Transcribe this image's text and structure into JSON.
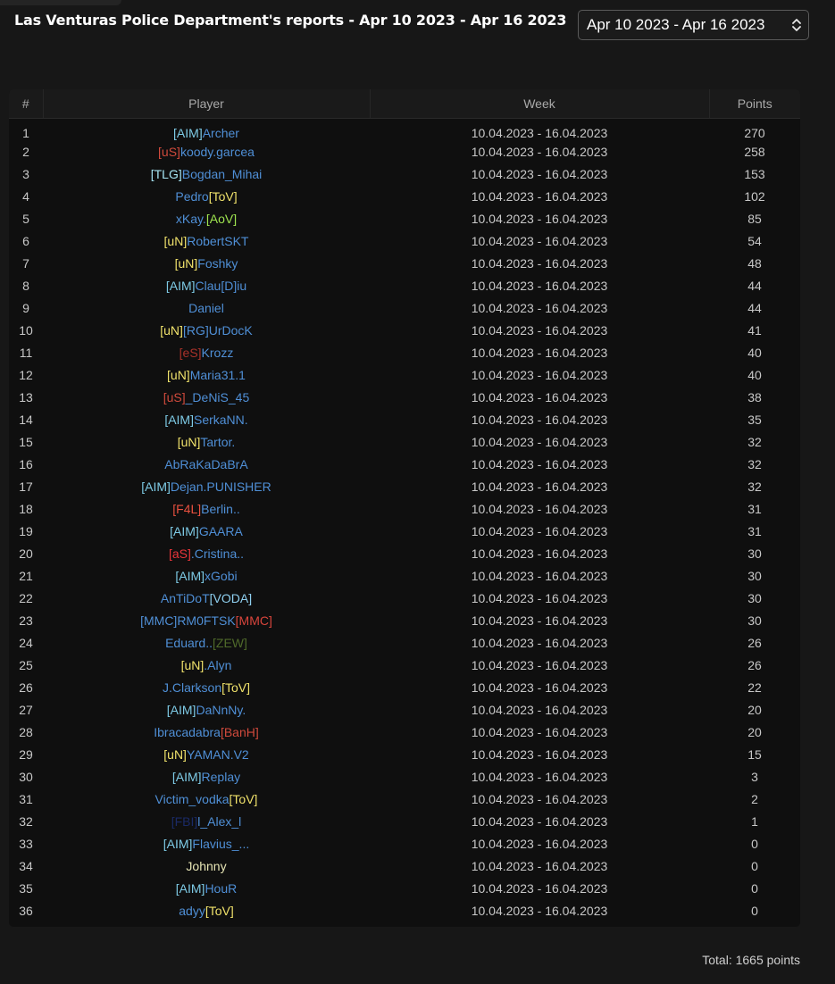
{
  "page": {
    "title": "Las Venturas Police Department's reports - Apr 10 2023 - Apr 16 2023",
    "range_select": {
      "selected": "Apr 10 2023 - Apr 16 2023"
    },
    "total": "Total: 1665 points"
  },
  "colors": {
    "background": "#171717",
    "table_bg": "#0f0f0f",
    "name_blue": "#4f8fd6",
    "tag_cyan": "#7ecbe6",
    "tag_yellow": "#f0e26b",
    "tag_red": "#d9453c",
    "tag_green": "#9ee44f"
  },
  "table": {
    "headers": [
      "#",
      "Player",
      "Week",
      "Points"
    ],
    "rows": [
      {
        "num": "1",
        "week": "10.04.2023 - 16.04.2023",
        "points": "270",
        "player": [
          {
            "t": "[AIM]",
            "c": "#7ecbe6"
          },
          {
            "t": "Archer",
            "c": "name"
          }
        ]
      },
      {
        "num": "2",
        "week": "10.04.2023 - 16.04.2023",
        "points": "258",
        "player": [
          {
            "t": "[uS]",
            "c": "#d04a3c"
          },
          {
            "t": "koody.garcea",
            "c": "name"
          }
        ]
      },
      {
        "num": "3",
        "week": "10.04.2023 - 16.04.2023",
        "points": "153",
        "player": [
          {
            "t": "[TLG]",
            "c": "#a6e4f3"
          },
          {
            "t": "Bogdan_Mihai",
            "c": "name"
          }
        ]
      },
      {
        "num": "4",
        "week": "10.04.2023 - 16.04.2023",
        "points": "102",
        "player": [
          {
            "t": "Pedro",
            "c": "name"
          },
          {
            "t": "[ToV]",
            "c": "#f0e26b"
          }
        ]
      },
      {
        "num": "5",
        "week": "10.04.2023 - 16.04.2023",
        "points": "85",
        "player": [
          {
            "t": "xKay.",
            "c": "name"
          },
          {
            "t": "[AoV]",
            "c": "#9ee44f"
          }
        ]
      },
      {
        "num": "6",
        "week": "10.04.2023 - 16.04.2023",
        "points": "54",
        "player": [
          {
            "t": "[uN]",
            "c": "#f0e26b"
          },
          {
            "t": "RobertSKT",
            "c": "name"
          }
        ]
      },
      {
        "num": "7",
        "week": "10.04.2023 - 16.04.2023",
        "points": "48",
        "player": [
          {
            "t": "[uN]",
            "c": "#f0e26b"
          },
          {
            "t": "Foshky",
            "c": "name"
          }
        ]
      },
      {
        "num": "8",
        "week": "10.04.2023 - 16.04.2023",
        "points": "44",
        "player": [
          {
            "t": "[AIM]",
            "c": "#7ecbe6"
          },
          {
            "t": "Clau[D]iu",
            "c": "name"
          }
        ]
      },
      {
        "num": "9",
        "week": "10.04.2023 - 16.04.2023",
        "points": "44",
        "player": [
          {
            "t": "Daniel",
            "c": "name"
          }
        ]
      },
      {
        "num": "10",
        "week": "10.04.2023 - 16.04.2023",
        "points": "41",
        "player": [
          {
            "t": "[uN]",
            "c": "#f0e26b"
          },
          {
            "t": "[RG]UrDocK",
            "c": "name"
          }
        ]
      },
      {
        "num": "11",
        "week": "10.04.2023 - 16.04.2023",
        "points": "40",
        "player": [
          {
            "t": "[eS]",
            "c": "#a8322a"
          },
          {
            "t": "Krozz",
            "c": "name"
          }
        ]
      },
      {
        "num": "12",
        "week": "10.04.2023 - 16.04.2023",
        "points": "40",
        "player": [
          {
            "t": "[uN]",
            "c": "#f0e26b"
          },
          {
            "t": "Maria31.1",
            "c": "name"
          }
        ]
      },
      {
        "num": "13",
        "week": "10.04.2023 - 16.04.2023",
        "points": "38",
        "player": [
          {
            "t": "[uS]",
            "c": "#d04a3c"
          },
          {
            "t": "_DeNiS_45",
            "c": "name"
          }
        ]
      },
      {
        "num": "14",
        "week": "10.04.2023 - 16.04.2023",
        "points": "35",
        "player": [
          {
            "t": "[AIM]",
            "c": "#7ecbe6"
          },
          {
            "t": "SerkaNN.",
            "c": "name"
          }
        ]
      },
      {
        "num": "15",
        "week": "10.04.2023 - 16.04.2023",
        "points": "32",
        "player": [
          {
            "t": "[uN]",
            "c": "#f0e26b"
          },
          {
            "t": "Tartor.",
            "c": "name"
          }
        ]
      },
      {
        "num": "16",
        "week": "10.04.2023 - 16.04.2023",
        "points": "32",
        "player": [
          {
            "t": "AbRaKaDaBrA",
            "c": "name"
          }
        ]
      },
      {
        "num": "17",
        "week": "10.04.2023 - 16.04.2023",
        "points": "32",
        "player": [
          {
            "t": "[AIM]",
            "c": "#7ecbe6"
          },
          {
            "t": "Dejan.PUNISHER",
            "c": "name"
          }
        ]
      },
      {
        "num": "18",
        "week": "10.04.2023 - 16.04.2023",
        "points": "31",
        "player": [
          {
            "t": "[F4L]",
            "c": "#e8503f"
          },
          {
            "t": "Berlin..",
            "c": "name"
          }
        ]
      },
      {
        "num": "19",
        "week": "10.04.2023 - 16.04.2023",
        "points": "31",
        "player": [
          {
            "t": "[AIM]",
            "c": "#7ecbe6"
          },
          {
            "t": "GAARA",
            "c": "name"
          }
        ]
      },
      {
        "num": "20",
        "week": "10.04.2023 - 16.04.2023",
        "points": "30",
        "player": [
          {
            "t": "[aS]",
            "c": "#e8353a"
          },
          {
            "t": ".Cristina..",
            "c": "name"
          }
        ]
      },
      {
        "num": "21",
        "week": "10.04.2023 - 16.04.2023",
        "points": "30",
        "player": [
          {
            "t": "[AIM]",
            "c": "#7ecbe6"
          },
          {
            "t": "xGobi",
            "c": "name"
          }
        ]
      },
      {
        "num": "22",
        "week": "10.04.2023 - 16.04.2023",
        "points": "30",
        "player": [
          {
            "t": "AnTiDoT",
            "c": "name"
          },
          {
            "t": "[VODA]",
            "c": "#8fd0f0"
          }
        ]
      },
      {
        "num": "23",
        "week": "10.04.2023 - 16.04.2023",
        "points": "30",
        "player": [
          {
            "t": "[MMC]RM0FTSK",
            "c": "name"
          },
          {
            "t": "[MMC]",
            "c": "#d9453c"
          }
        ]
      },
      {
        "num": "24",
        "week": "10.04.2023 - 16.04.2023",
        "points": "26",
        "player": [
          {
            "t": "Eduard..",
            "c": "name"
          },
          {
            "t": "[ZEW]",
            "c": "#4f6a2a"
          }
        ]
      },
      {
        "num": "25",
        "week": "10.04.2023 - 16.04.2023",
        "points": "26",
        "player": [
          {
            "t": "[uN]",
            "c": "#f0e26b"
          },
          {
            "t": ".Alyn",
            "c": "name"
          }
        ]
      },
      {
        "num": "26",
        "week": "10.04.2023 - 16.04.2023",
        "points": "22",
        "player": [
          {
            "t": "J.Clarkson",
            "c": "name"
          },
          {
            "t": "[ToV]",
            "c": "#f0e26b"
          }
        ]
      },
      {
        "num": "27",
        "week": "10.04.2023 - 16.04.2023",
        "points": "20",
        "player": [
          {
            "t": "[AIM]",
            "c": "#7ecbe6"
          },
          {
            "t": "DaNnNy.",
            "c": "name"
          }
        ]
      },
      {
        "num": "28",
        "week": "10.04.2023 - 16.04.2023",
        "points": "20",
        "player": [
          {
            "t": "Ibracadabra",
            "c": "name"
          },
          {
            "t": "[BanH]",
            "c": "#d04a3c"
          }
        ]
      },
      {
        "num": "29",
        "week": "10.04.2023 - 16.04.2023",
        "points": "15",
        "player": [
          {
            "t": "[uN]",
            "c": "#f0e26b"
          },
          {
            "t": "YAMAN.V2",
            "c": "name"
          }
        ]
      },
      {
        "num": "30",
        "week": "10.04.2023 - 16.04.2023",
        "points": "3",
        "player": [
          {
            "t": "[AIM]",
            "c": "#7ecbe6"
          },
          {
            "t": "Replay",
            "c": "name"
          }
        ]
      },
      {
        "num": "31",
        "week": "10.04.2023 - 16.04.2023",
        "points": "2",
        "player": [
          {
            "t": "Victim_vodka",
            "c": "name"
          },
          {
            "t": "[ToV]",
            "c": "#f0e26b"
          }
        ]
      },
      {
        "num": "32",
        "week": "10.04.2023 - 16.04.2023",
        "points": "1",
        "player": [
          {
            "t": "[FBI]",
            "c": "#1a2a66"
          },
          {
            "t": "l_Alex_l",
            "c": "name"
          }
        ]
      },
      {
        "num": "33",
        "week": "10.04.2023 - 16.04.2023",
        "points": "0",
        "player": [
          {
            "t": "[AIM]",
            "c": "#7ecbe6"
          },
          {
            "t": "Flavius_...",
            "c": "name"
          }
        ]
      },
      {
        "num": "34",
        "week": "10.04.2023 - 16.04.2023",
        "points": "0",
        "player": [
          {
            "t": "Johnny",
            "c": "#e6e4b4"
          }
        ]
      },
      {
        "num": "35",
        "week": "10.04.2023 - 16.04.2023",
        "points": "0",
        "player": [
          {
            "t": "[AIM]",
            "c": "#7ecbe6"
          },
          {
            "t": "HouR",
            "c": "name"
          }
        ]
      },
      {
        "num": "36",
        "week": "10.04.2023 - 16.04.2023",
        "points": "0",
        "player": [
          {
            "t": "adyy",
            "c": "name"
          },
          {
            "t": "[ToV]",
            "c": "#f0e26b"
          }
        ]
      }
    ]
  }
}
